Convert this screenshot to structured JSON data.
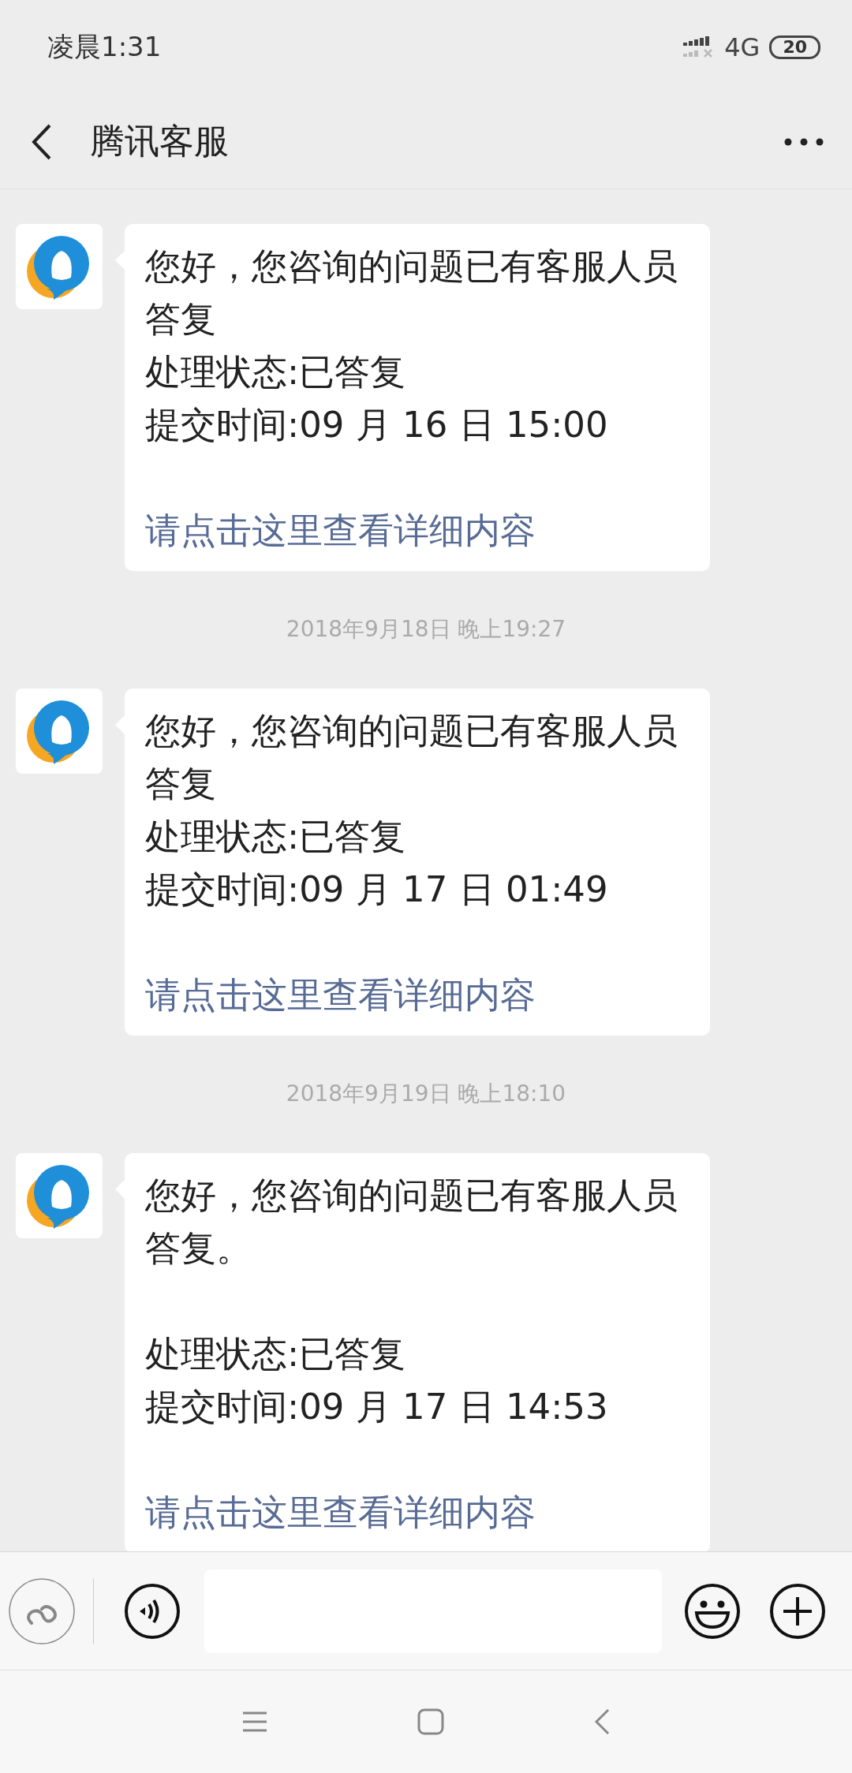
{
  "status_bar": {
    "time": "凌晨1:31",
    "network": "4G",
    "battery": "20"
  },
  "header": {
    "title": "腾讯客服"
  },
  "messages": [
    {
      "kind": "message",
      "lines": [
        {
          "kind": "text",
          "text": "您好，您咨询的问题已有客服人员答复"
        },
        {
          "kind": "text",
          "text": "处理状态:已答复"
        },
        {
          "kind": "text",
          "text": "提交时间:09 月 16 日 15:00"
        },
        {
          "kind": "blank"
        },
        {
          "kind": "link",
          "text": "请点击这里查看详细内容"
        }
      ]
    },
    {
      "kind": "timestamp",
      "text": "2018年9月18日 晚上19:27"
    },
    {
      "kind": "message",
      "lines": [
        {
          "kind": "text",
          "text": "您好，您咨询的问题已有客服人员答复"
        },
        {
          "kind": "text",
          "text": "处理状态:已答复"
        },
        {
          "kind": "text",
          "text": "提交时间:09 月 17 日 01:49"
        },
        {
          "kind": "blank"
        },
        {
          "kind": "link",
          "text": "请点击这里查看详细内容"
        }
      ]
    },
    {
      "kind": "timestamp",
      "text": "2018年9月19日 晚上18:10"
    },
    {
      "kind": "message",
      "lines": [
        {
          "kind": "text",
          "text": "您好，您咨询的问题已有客服人员答复。"
        },
        {
          "kind": "blank"
        },
        {
          "kind": "text",
          "text": "处理状态:已答复"
        },
        {
          "kind": "text",
          "text": "提交时间:09 月 17 日 14:53"
        },
        {
          "kind": "blank"
        },
        {
          "kind": "link",
          "text": "请点击这里查看详细内容"
        }
      ]
    }
  ]
}
